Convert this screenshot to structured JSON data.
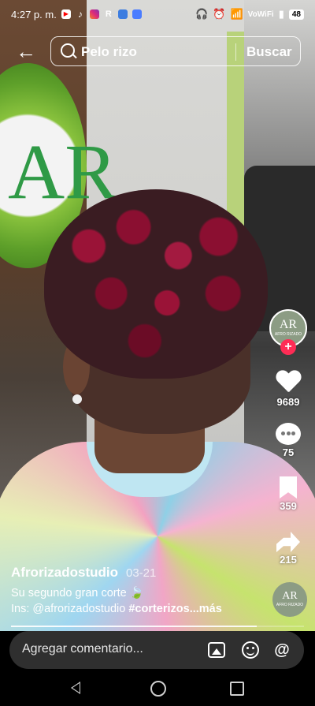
{
  "status_bar": {
    "time": "4:27 p. m.",
    "network": "VoWiFi",
    "battery": "48",
    "notification_icons": [
      "youtube-icon",
      "tiktok-icon",
      "instagram-icon",
      "r-app-icon",
      "bluetooth-app-icon",
      "app-icon"
    ],
    "system_icons": [
      "headphones-icon",
      "alarm-icon",
      "wifi-icon",
      "signal-icon"
    ]
  },
  "search": {
    "query": "Pelo rizo",
    "button_label": "Buscar"
  },
  "video": {
    "author": "Afrorizadostudio",
    "date": "03-21",
    "description_line1": "Su segundo gran corte 🍃",
    "description_prefix": "Ins: @afrorizadostudio ",
    "hashtag": "#corterizos",
    "more_label": "...más",
    "progress": 0.84
  },
  "actions": {
    "likes": "9689",
    "comments": "75",
    "saves": "359",
    "shares": "215"
  },
  "profile": {
    "logo_text": "AR",
    "brand_text": "AFRO RIZADO",
    "follow_symbol": "+"
  },
  "comment_bar": {
    "placeholder": "Agregar comentario..."
  },
  "colors": {
    "follow_accent": "#fe2c55",
    "comment_box": "#2f2f2f"
  }
}
